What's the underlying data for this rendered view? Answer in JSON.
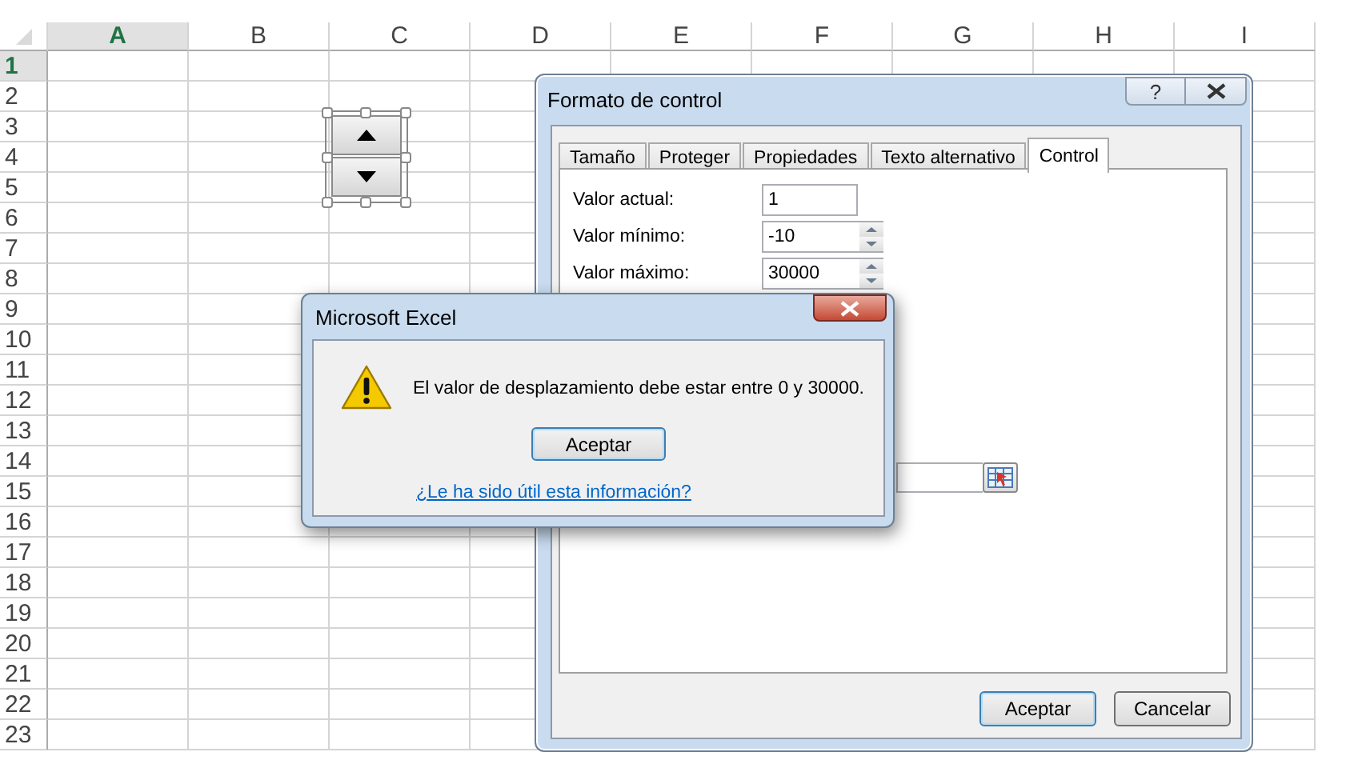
{
  "sheet": {
    "columns": [
      {
        "label": "A",
        "selected": true
      },
      {
        "label": "B",
        "selected": false
      },
      {
        "label": "C",
        "selected": false
      },
      {
        "label": "D",
        "selected": false
      },
      {
        "label": "E",
        "selected": false
      },
      {
        "label": "F",
        "selected": false
      },
      {
        "label": "G",
        "selected": false
      },
      {
        "label": "H",
        "selected": false
      },
      {
        "label": "I",
        "selected": false
      }
    ],
    "rows": [
      {
        "label": "1",
        "selected": true
      },
      {
        "label": "2",
        "selected": false
      },
      {
        "label": "3",
        "selected": false
      },
      {
        "label": "4",
        "selected": false
      },
      {
        "label": "5",
        "selected": false
      },
      {
        "label": "6",
        "selected": false
      },
      {
        "label": "7",
        "selected": false
      },
      {
        "label": "8",
        "selected": false
      },
      {
        "label": "9",
        "selected": false
      },
      {
        "label": "10",
        "selected": false
      },
      {
        "label": "11",
        "selected": false
      },
      {
        "label": "12",
        "selected": false
      },
      {
        "label": "13",
        "selected": false
      },
      {
        "label": "14",
        "selected": false
      },
      {
        "label": "15",
        "selected": false
      },
      {
        "label": "16",
        "selected": false
      },
      {
        "label": "17",
        "selected": false
      },
      {
        "label": "18",
        "selected": false
      },
      {
        "label": "19",
        "selected": false
      },
      {
        "label": "20",
        "selected": false
      },
      {
        "label": "21",
        "selected": false
      },
      {
        "label": "22",
        "selected": false
      },
      {
        "label": "23",
        "selected": false
      }
    ]
  },
  "spin_button": {
    "selected": true
  },
  "format_dialog": {
    "title": "Formato de control",
    "help_button": "?",
    "tabs": [
      {
        "label": "Tamaño",
        "selected": false
      },
      {
        "label": "Proteger",
        "selected": false
      },
      {
        "label": "Propiedades",
        "selected": false
      },
      {
        "label": "Texto alternativo",
        "selected": false
      },
      {
        "label": "Control",
        "selected": true
      }
    ],
    "fields": [
      {
        "label": "Valor actual:",
        "value": "1",
        "kind": "text"
      },
      {
        "label": "Valor mínimo:",
        "value": "-10",
        "kind": "spinner"
      },
      {
        "label": "Valor máximo:",
        "value": "30000",
        "kind": "spinner"
      }
    ],
    "buttons": [
      {
        "label": "Aceptar",
        "default": true
      },
      {
        "label": "Cancelar",
        "default": false
      }
    ]
  },
  "message_box": {
    "title": "Microsoft Excel",
    "message": "El valor de desplazamiento debe estar entre 0 y 30000.",
    "button": "Aceptar",
    "link": "¿Le ha sido útil esta información?"
  }
}
